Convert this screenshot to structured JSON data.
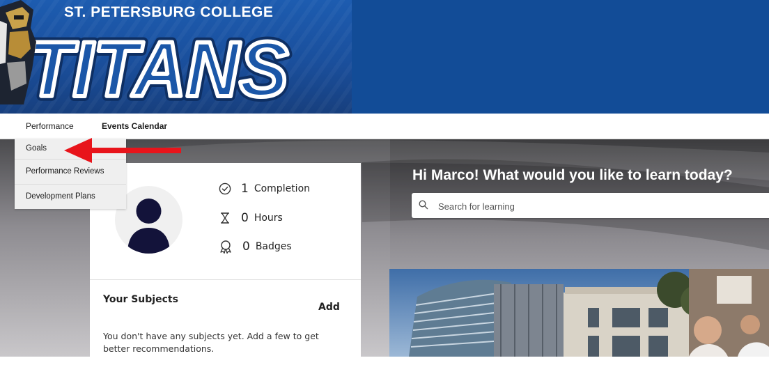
{
  "banner": {
    "college_name": "ST. PETERSBURG COLLEGE",
    "team_name": "TITANS"
  },
  "nav": {
    "items": [
      {
        "label": "Performance"
      },
      {
        "label": "Events Calendar"
      }
    ]
  },
  "dropdown": {
    "items": [
      {
        "label": "Goals"
      },
      {
        "label": "Performance Reviews"
      },
      {
        "label": "Development Plans"
      }
    ]
  },
  "profile": {
    "stats": [
      {
        "icon": "check-circle-icon",
        "value": "1",
        "label": "Completion"
      },
      {
        "icon": "hourglass-icon",
        "value": "0",
        "label": "Hours"
      },
      {
        "icon": "badge-icon",
        "value": "0",
        "label": "Badges"
      }
    ],
    "subjects_title": "Your Subjects",
    "add_label": "Add",
    "subjects_message": "You don't have any subjects yet. Add a few to get better recommendations."
  },
  "hero": {
    "greeting": "Hi Marco! What would you like to learn today?",
    "search_placeholder": "Search for learning"
  },
  "colors": {
    "banner_blue": "#124c97",
    "arrow_red": "#e8141b"
  }
}
